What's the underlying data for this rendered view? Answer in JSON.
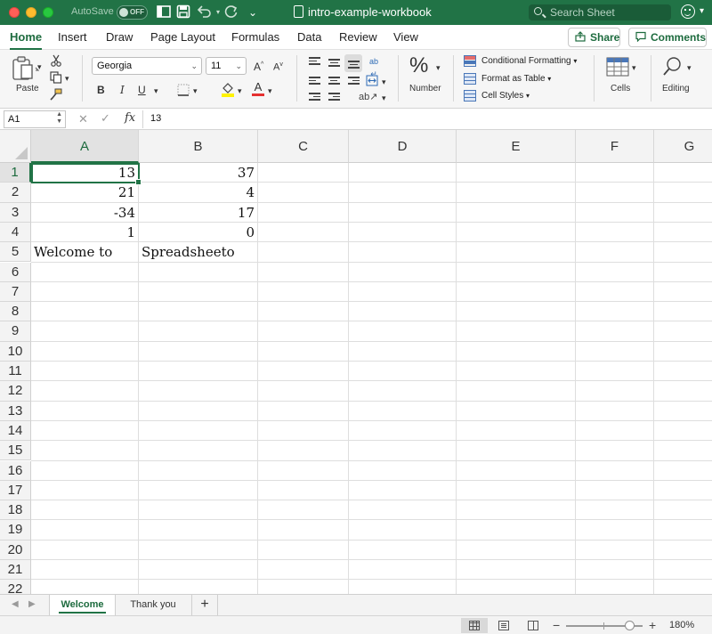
{
  "titlebar": {
    "autosave_label": "AutoSave",
    "autosave_state": "OFF",
    "doc_title": "intro-example-workbook",
    "search_placeholder": "Search Sheet"
  },
  "ribbon_tabs": [
    "Home",
    "Insert",
    "Draw",
    "Page Layout",
    "Formulas",
    "Data",
    "Review",
    "View"
  ],
  "active_tab": "Home",
  "share_label": "Share",
  "comments_label": "Comments",
  "ribbon": {
    "paste_label": "Paste",
    "font_name": "Georgia",
    "font_size": "11",
    "grow_font": "A",
    "shrink_font": "A",
    "bold": "B",
    "italic": "I",
    "underline": "U",
    "font_color_glyph": "A",
    "number_label": "Number",
    "number_glyph": "%",
    "conditional_formatting": "Conditional Formatting",
    "format_as_table": "Format as Table",
    "cell_styles": "Cell Styles",
    "cells_label": "Cells",
    "editing_label": "Editing"
  },
  "formula_bar": {
    "name_box": "A1",
    "cancel_glyph": "✕",
    "enter_glyph": "✓",
    "fx": "fx",
    "value": "13"
  },
  "grid": {
    "columns": [
      "A",
      "B",
      "C",
      "D",
      "E",
      "F",
      "G"
    ],
    "selected_column": "A",
    "rows": [
      "1",
      "2",
      "3",
      "4",
      "5",
      "6",
      "7",
      "8",
      "9",
      "10",
      "11",
      "12",
      "13",
      "14",
      "15",
      "16",
      "17",
      "18",
      "19",
      "20",
      "21",
      "22"
    ],
    "selected_row": "1",
    "cells": {
      "A1": "13",
      "B1": "37",
      "A2": "21",
      "B2": "4",
      "A3": "-34",
      "B3": "17",
      "A4": "1",
      "B4": "0",
      "A5": "Welcome to",
      "B5": "Spreadsheeto"
    }
  },
  "sheet_tabs": [
    "Welcome",
    "Thank you"
  ],
  "active_sheet": "Welcome",
  "add_sheet_glyph": "+",
  "status": {
    "zoom_out": "−",
    "zoom_in": "+",
    "zoom_pct": "180%",
    "zoom_value": 180
  },
  "colors": {
    "brand_green": "#217346",
    "selection_green": "#217346"
  }
}
